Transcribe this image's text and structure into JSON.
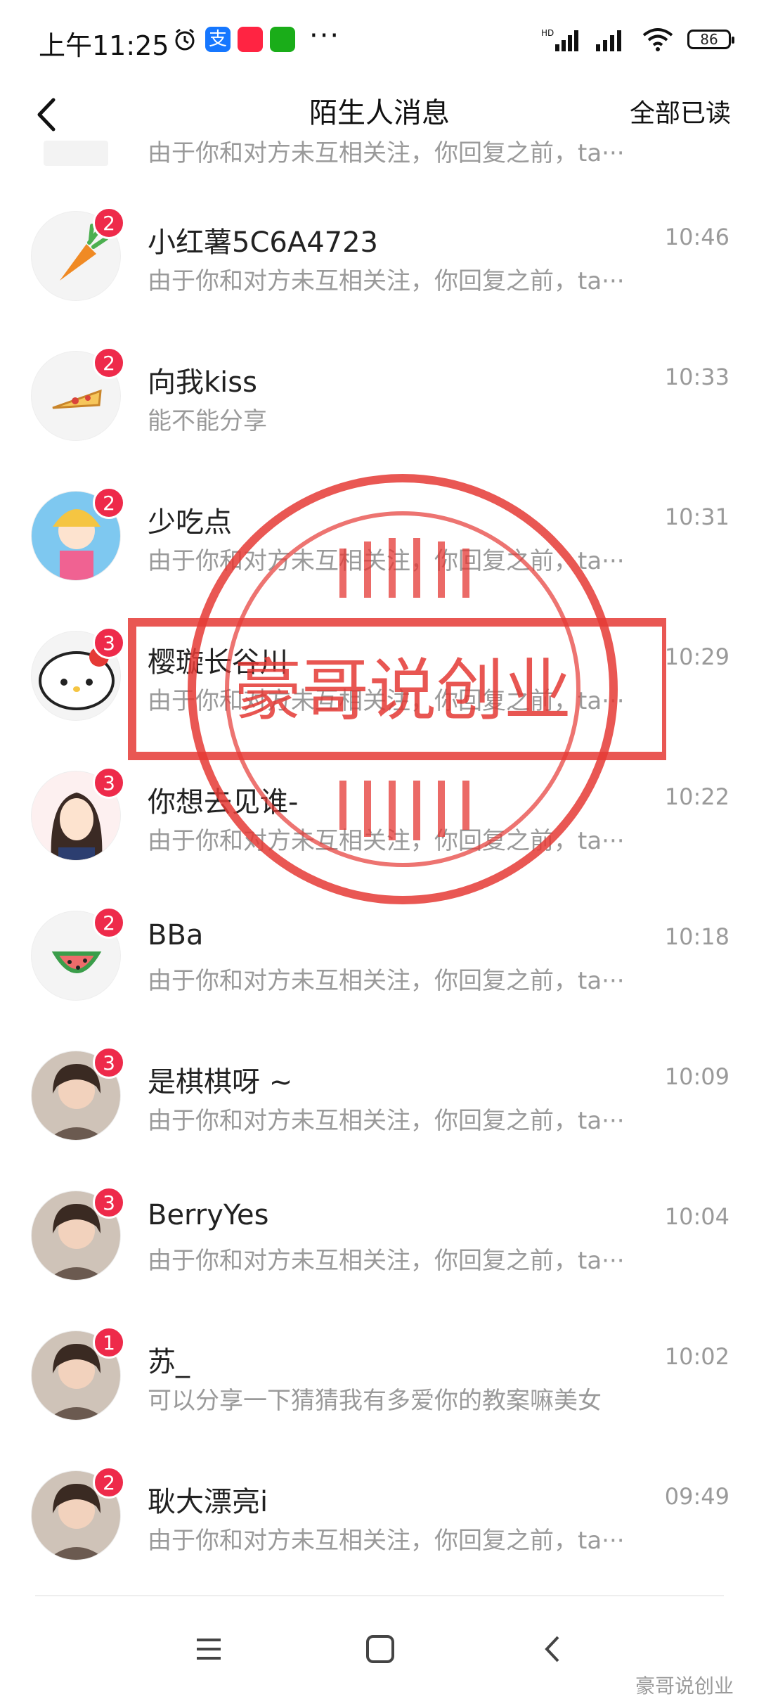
{
  "statusbar": {
    "time": "上午11:25",
    "signal1_label": "HD",
    "battery": "86"
  },
  "header": {
    "title": "陌生人消息",
    "read_all": "全部已读"
  },
  "partial_row": {
    "message": "由于你和对方未互相关注，你回复之前，ta···"
  },
  "conversations": [
    {
      "name": "小红薯5C6A4723",
      "time": "10:46",
      "message": "由于你和对方未互相关注，你回复之前，ta···",
      "badge": "2",
      "avatar_icon": "carrot-icon"
    },
    {
      "name": "向我kiss",
      "time": "10:33",
      "message": "能不能分享",
      "badge": "2",
      "avatar_icon": "pizza-icon"
    },
    {
      "name": "少吃点",
      "time": "10:31",
      "message": "由于你和对方未互相关注，你回复之前，ta···",
      "badge": "2",
      "avatar_icon": "anime-avatar"
    },
    {
      "name": "樱璇长谷川",
      "time": "10:29",
      "message": "由于你和对方未互相关注，你回复之前，ta···",
      "badge": "3",
      "avatar_icon": "hello-kitty-icon"
    },
    {
      "name": "你想去见谁-",
      "time": "10:22",
      "message": "由于你和对方未互相关注，你回复之前，ta···",
      "badge": "3",
      "avatar_icon": "girl-illustration-avatar"
    },
    {
      "name": "BBa",
      "time": "10:18",
      "message": "由于你和对方未互相关注，你回复之前，ta···",
      "badge": "2",
      "avatar_icon": "watermelon-icon"
    },
    {
      "name": "是棋棋呀 ~",
      "time": "10:09",
      "message": "由于你和对方未互相关注，你回复之前，ta···",
      "badge": "3",
      "avatar_icon": "photo-avatar"
    },
    {
      "name": "BerryYes",
      "time": "10:04",
      "message": "由于你和对方未互相关注，你回复之前，ta···",
      "badge": "3",
      "avatar_icon": "photo-avatar"
    },
    {
      "name": "苏_",
      "time": "10:02",
      "message": "可以分享一下猜猜我有多爱你的教案嘛美女",
      "badge": "1",
      "avatar_icon": "photo-avatar"
    },
    {
      "name": "耿大漂亮i",
      "time": "09:49",
      "message": "由于你和对方未互相关注，你回复之前，ta···",
      "badge": "2",
      "avatar_icon": "photo-avatar"
    }
  ],
  "stamp": {
    "text": "豪哥说创业",
    "color": "#e53935"
  },
  "watermark": "豪哥说创业",
  "colors": {
    "badge": "#ee2a4a",
    "secondary_text": "#9a9a9a"
  }
}
